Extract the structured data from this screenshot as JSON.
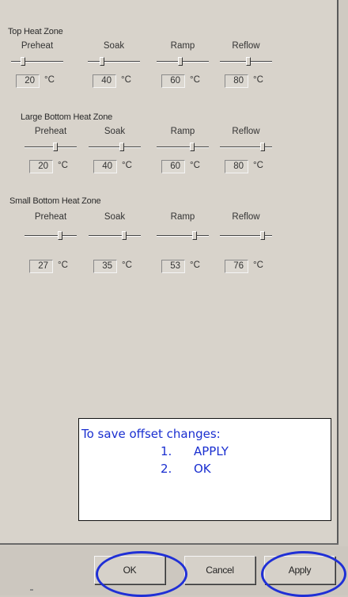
{
  "zones": [
    {
      "title": "Top Heat Zone",
      "phases": [
        {
          "label": "Preheat",
          "value": "20",
          "unit": "°C",
          "slider": 0.2
        },
        {
          "label": "Soak",
          "value": "40",
          "unit": "°C",
          "slider": 0.25
        },
        {
          "label": "Ramp",
          "value": "60",
          "unit": "°C",
          "slider": 0.45
        },
        {
          "label": "Reflow",
          "value": "80",
          "unit": "°C",
          "slider": 0.55
        }
      ]
    },
    {
      "title": "Large Bottom Heat Zone",
      "phases": [
        {
          "label": "Preheat",
          "value": "20",
          "unit": "°C",
          "slider": 0.6
        },
        {
          "label": "Soak",
          "value": "40",
          "unit": "°C",
          "slider": 0.65
        },
        {
          "label": "Ramp",
          "value": "60",
          "unit": "°C",
          "slider": 0.7
        },
        {
          "label": "Reflow",
          "value": "80",
          "unit": "°C",
          "slider": 0.85
        }
      ]
    },
    {
      "title": "Small Bottom Heat Zone",
      "phases": [
        {
          "label": "Preheat",
          "value": "27",
          "unit": "°C",
          "slider": 0.7
        },
        {
          "label": "Soak",
          "value": "35",
          "unit": "°C",
          "slider": 0.7
        },
        {
          "label": "Ramp",
          "value": "53",
          "unit": "°C",
          "slider": 0.75
        },
        {
          "label": "Reflow",
          "value": "76",
          "unit": "°C",
          "slider": 0.85
        }
      ]
    }
  ],
  "note": {
    "title": "To save offset changes:",
    "steps": [
      {
        "num": "1.",
        "text": "APPLY"
      },
      {
        "num": "2.",
        "text": "OK"
      }
    ]
  },
  "buttons": {
    "ok": "OK",
    "cancel": "Cancel",
    "apply": "Apply"
  },
  "colors": {
    "annotation": "#1f2fd6"
  }
}
